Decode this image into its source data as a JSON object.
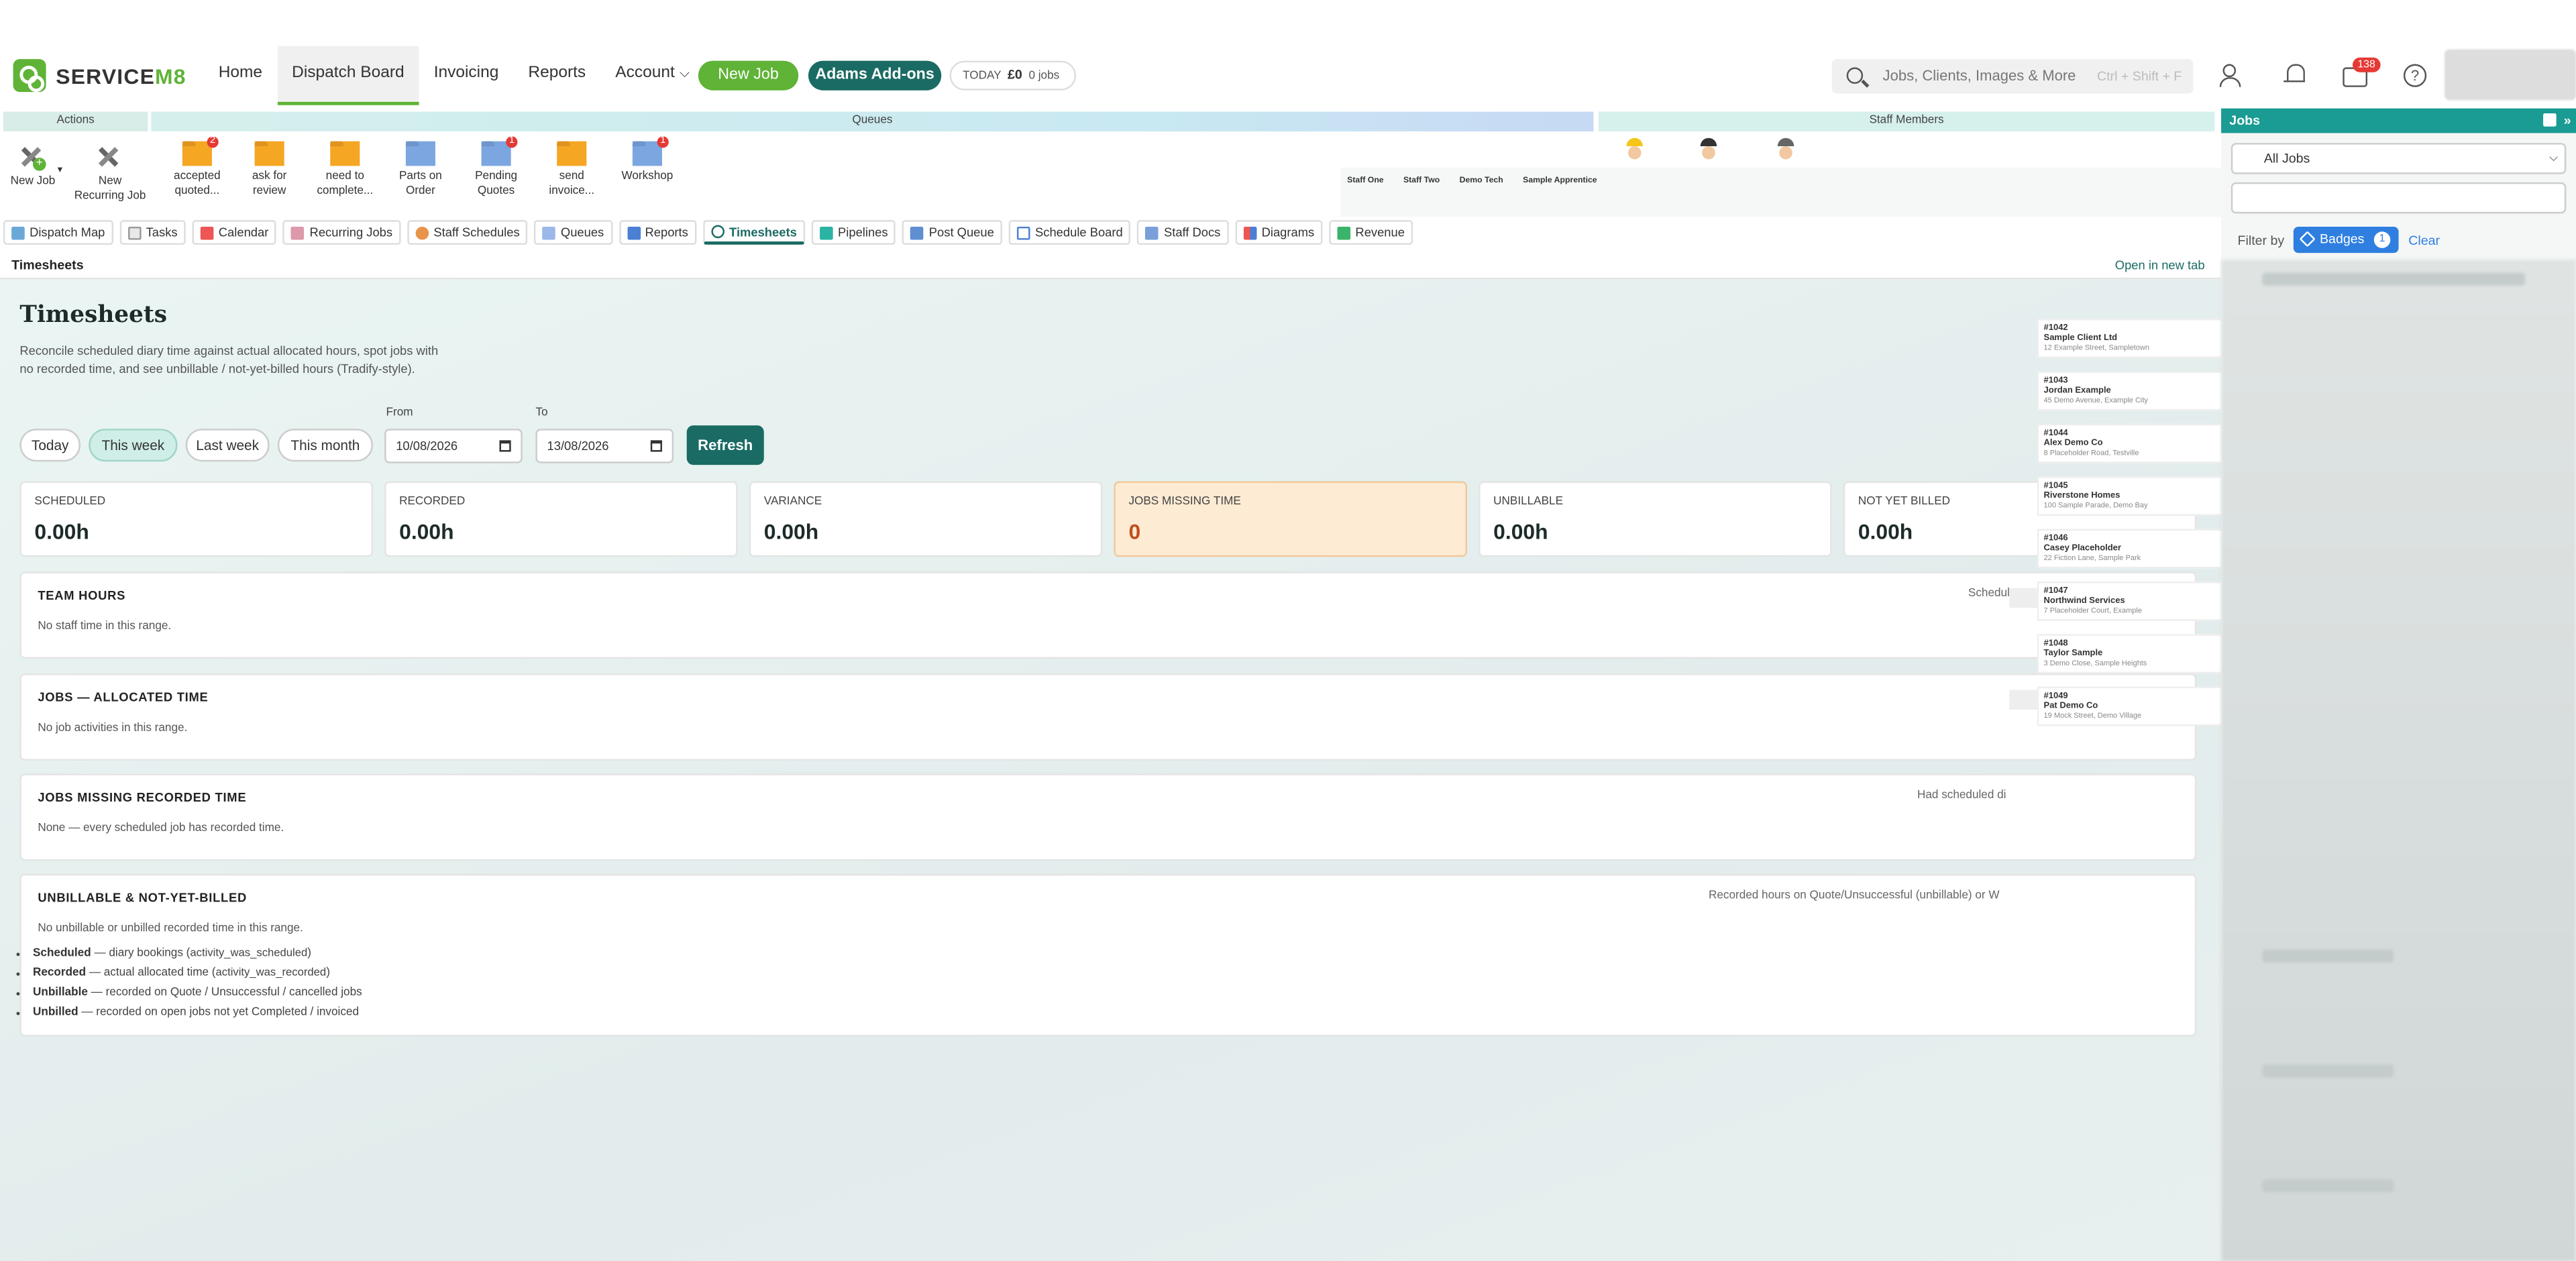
{
  "app": {
    "logo_text": "SERVICE",
    "logo_suffix": "M8"
  },
  "nav": [
    {
      "label": "Home"
    },
    {
      "label": "Dispatch Board"
    },
    {
      "label": "Invoicing"
    },
    {
      "label": "Reports"
    },
    {
      "label": "Account"
    }
  ],
  "header": {
    "new_job": "New Job",
    "addons": "Adams Add-ons",
    "today_label": "TODAY",
    "today_amount": "£0",
    "today_jobs": "0 jobs",
    "search_placeholder": "Jobs, Clients, Images & More",
    "search_shortcut": "Ctrl + Shift + F",
    "inbox_badge": "138"
  },
  "band": {
    "actions_label": "Actions",
    "queues_label": "Queues",
    "staff_label": "Staff Members",
    "actions": [
      {
        "label": "New Job"
      },
      {
        "label": "New Recurring Job"
      }
    ],
    "queues": [
      {
        "label": "accepted quoted...",
        "badge": "2",
        "color": "orange"
      },
      {
        "label": "ask for review",
        "badge": "",
        "color": "orange"
      },
      {
        "label": "need to complete...",
        "badge": "",
        "color": "orange"
      },
      {
        "label": "Parts on Order",
        "badge": "",
        "color": "blue"
      },
      {
        "label": "Pending Quotes",
        "badge": "1",
        "color": "blue"
      },
      {
        "label": "send invoice...",
        "badge": "",
        "color": "orange"
      },
      {
        "label": "Workshop",
        "badge": "1",
        "color": "blue"
      }
    ],
    "staff": [
      "Staff One",
      "Staff Two",
      "Demo Tech",
      "Sample Apprentice"
    ]
  },
  "tabs": [
    {
      "label": "Dispatch Map",
      "icon": "map-icon"
    },
    {
      "label": "Tasks",
      "icon": "tasks-icon"
    },
    {
      "label": "Calendar",
      "icon": "calendar-icon"
    },
    {
      "label": "Recurring Jobs",
      "icon": "recurring-icon"
    },
    {
      "label": "Staff Schedules",
      "icon": "staff-icon"
    },
    {
      "label": "Queues",
      "icon": "queues-icon"
    },
    {
      "label": "Reports",
      "icon": "reports-icon"
    },
    {
      "label": "Timesheets",
      "icon": "clock-icon"
    },
    {
      "label": "Pipelines",
      "icon": "pipelines-icon"
    },
    {
      "label": "Post Queue",
      "icon": "post-icon"
    },
    {
      "label": "Schedule Board",
      "icon": "board-icon"
    },
    {
      "label": "Staff Docs",
      "icon": "docs-icon"
    },
    {
      "label": "Diagrams",
      "icon": "diagrams-icon"
    },
    {
      "label": "Revenue",
      "icon": "revenue-icon"
    }
  ],
  "page": {
    "breadcrumb": "Timesheets",
    "open_new_tab": "Open in new tab",
    "title": "Timesheets",
    "intro": "Reconcile scheduled diary time against actual allocated hours, spot jobs with no recorded time, and see unbillable / not-yet-billed hours (Tradify-style).",
    "ranges": [
      "Today",
      "This week",
      "Last week",
      "This month"
    ],
    "from_label": "From",
    "to_label": "To",
    "from_value": "10/08/2026",
    "to_value": "13/08/2026",
    "refresh": "Refresh"
  },
  "stats": [
    {
      "label": "SCHEDULED",
      "value": "0.00h"
    },
    {
      "label": "RECORDED",
      "value": "0.00h"
    },
    {
      "label": "VARIANCE",
      "value": "0.00h"
    },
    {
      "label": "JOBS MISSING TIME",
      "value": "0"
    },
    {
      "label": "UNBILLABLE",
      "value": "0.00h"
    },
    {
      "label": "NOT YET BILLED",
      "value": "0.00h"
    }
  ],
  "cards": {
    "team": {
      "title": "TEAM HOURS",
      "sub": "No staff time in this range.",
      "right": "Schedul"
    },
    "jobs": {
      "title": "JOBS — ALLOCATED TIME",
      "sub": "No job activities in this range."
    },
    "missing": {
      "title": "JOBS MISSING RECORDED TIME",
      "sub": "None — every scheduled job has recorded time.",
      "right": "Had scheduled di"
    },
    "unbill": {
      "title": "UNBILLABLE & NOT-YET-BILLED",
      "sub": "No unbillable or unbilled recorded time in this range.",
      "right": "Recorded hours on Quote/Unsuccessful (unbillable) or W"
    }
  },
  "legend": [
    {
      "term": "Scheduled",
      "text": " — diary bookings (",
      "code": "activity_was_scheduled",
      "end": ")"
    },
    {
      "term": "Recorded",
      "text": " — actual allocated time (",
      "code": "activity_was_recorded",
      "end": ")"
    },
    {
      "term": "Unbillable",
      "text": " — recorded on Quote / Unsuccessful / cancelled jobs",
      "code": "",
      "end": ""
    },
    {
      "term": "Unbilled",
      "text": " — recorded on open jobs not yet Completed / invoiced",
      "code": "",
      "end": ""
    }
  ],
  "joblist": [
    {
      "num": "#1042",
      "client": "Sample Client Ltd",
      "addr": "12 Example Street, Sampletown"
    },
    {
      "num": "#1043",
      "client": "Jordan Example",
      "addr": "45 Demo Avenue, Example City"
    },
    {
      "num": "#1044",
      "client": "Alex Demo Co",
      "addr": "8 Placeholder Road, Testville"
    },
    {
      "num": "#1045",
      "client": "Riverstone Homes",
      "addr": "100 Sample Parade, Demo Bay"
    },
    {
      "num": "#1046",
      "client": "Casey Placeholder",
      "addr": "22 Fiction Lane, Sample Park"
    },
    {
      "num": "#1047",
      "client": "Northwind Services",
      "addr": "7 Placeholder Court, Example"
    },
    {
      "num": "#1048",
      "client": "Taylor Sample",
      "addr": "3 Demo Close, Sample Heights"
    },
    {
      "num": "#1049",
      "client": "Pat Demo Co",
      "addr": "19 Mock Street, Demo Village"
    }
  ],
  "jobs_panel": {
    "title": "Jobs",
    "select_value": "All Jobs",
    "filter_by": "Filter by",
    "badges_label": "Badges",
    "badges_count": "1",
    "clear": "Clear"
  },
  "colors": {
    "brand_green": "#5fb336",
    "teal": "#1a6b63",
    "jobs_header": "#1a9b93",
    "badge_red": "#e53935",
    "filter_blue": "#2f7fe0",
    "warn_bg": "#fdebd4",
    "warn_value": "#c24e1b"
  }
}
